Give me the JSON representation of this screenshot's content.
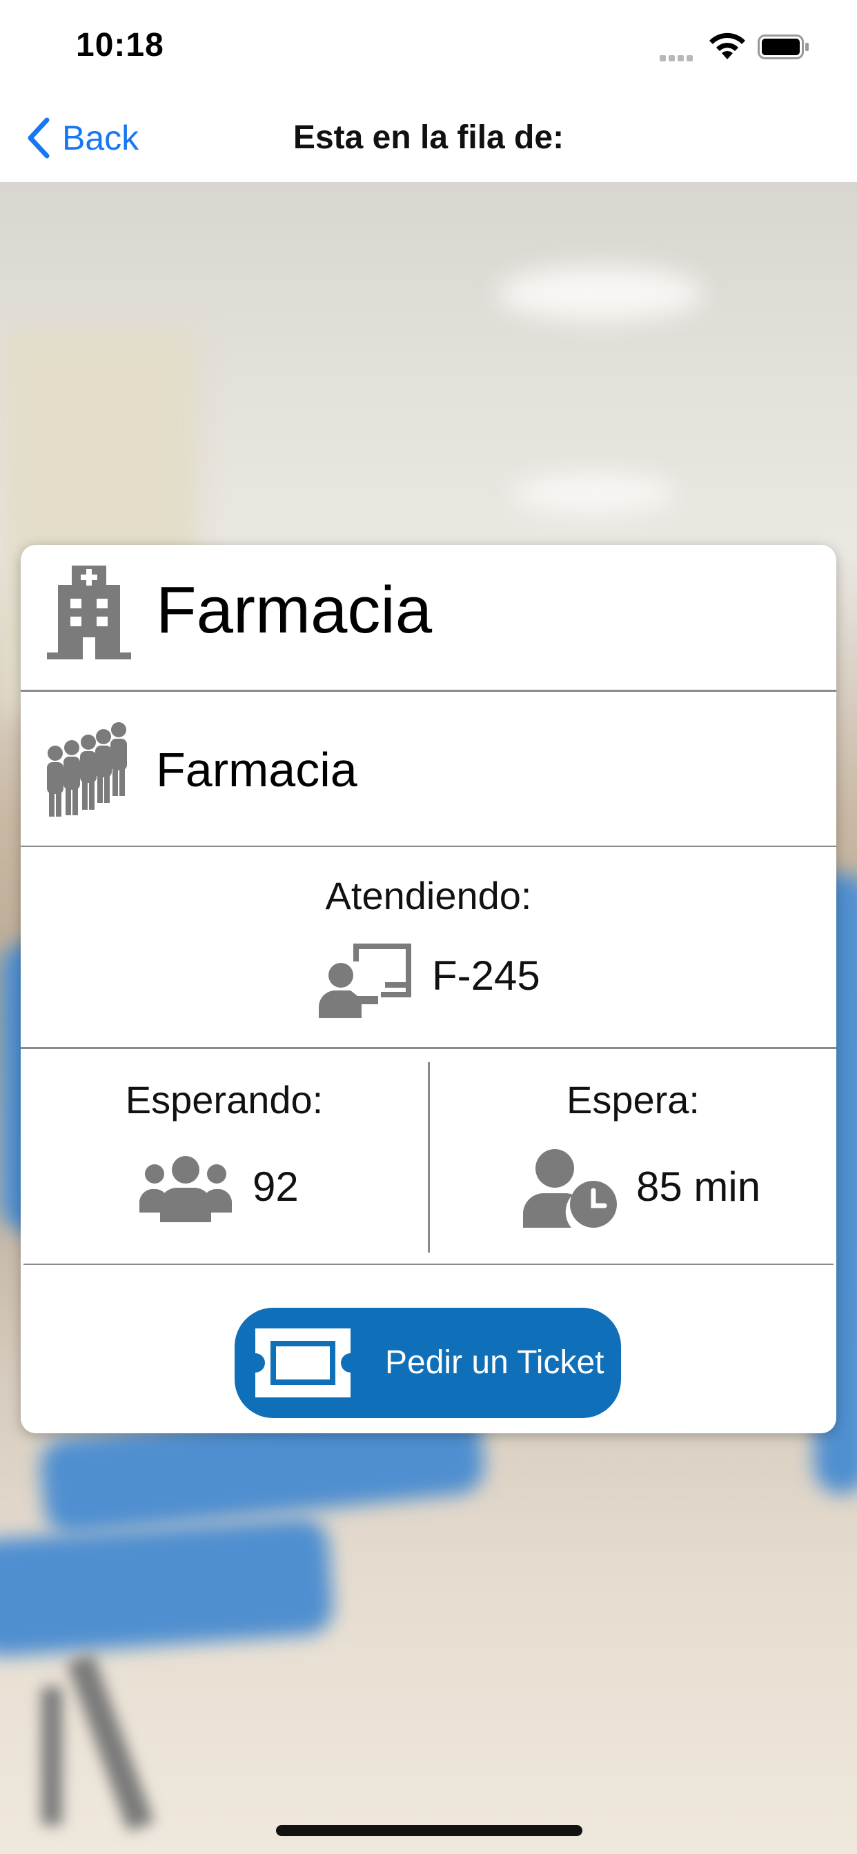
{
  "status_bar": {
    "time": "10:18"
  },
  "nav": {
    "back_label": "Back",
    "title": "Esta en la fila de:"
  },
  "card": {
    "facility": "Farmacia",
    "queue_name": "Farmacia",
    "serving_caption": "Atendiendo:",
    "serving_ticket": "F-245",
    "waiting_caption": "Esperando:",
    "waiting_count": "92",
    "wait_caption": "Espera:",
    "wait_time": "85 min",
    "request_button": "Pedir un Ticket"
  },
  "icons": [
    "back-chevron-icon",
    "hospital-building-icon",
    "queue-people-icon",
    "service-desk-icon",
    "group-icon",
    "user-clock-icon",
    "ticket-icon",
    "wifi-icon",
    "battery-icon",
    "signal-icon"
  ],
  "colors": {
    "accent_blue": "#1877f2",
    "button_blue": "#0f6fb8",
    "icon_gray": "#7b7b7b"
  }
}
